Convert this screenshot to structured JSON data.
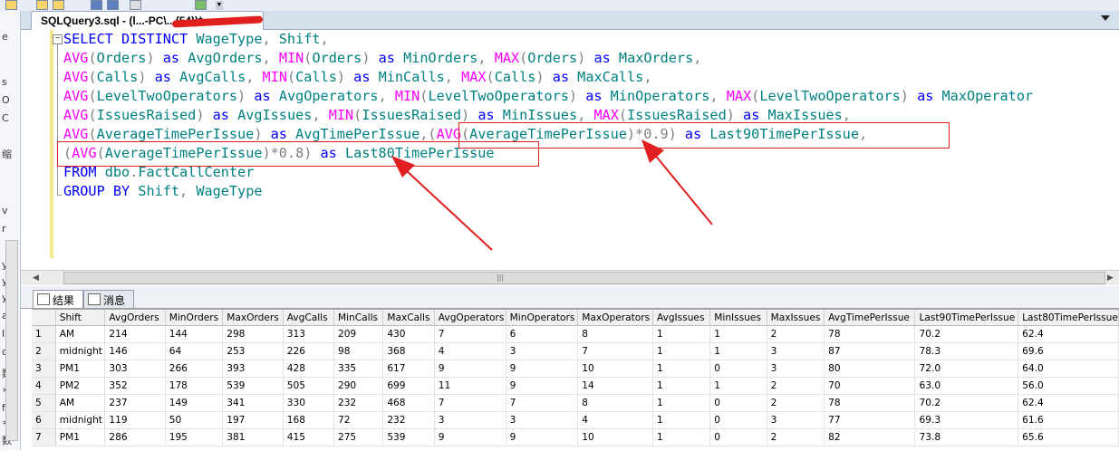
{
  "tab": {
    "title": "SQLQuery3.sql - (l...-PC\\...(54))*"
  },
  "code": {
    "l1": [
      "SELECT DISTINCT",
      "WageType",
      ",",
      "Shift",
      ","
    ],
    "l2": [
      "AVG",
      "(",
      "Orders",
      ")",
      "as",
      "AvgOrders",
      ",",
      "MIN",
      "(",
      "Orders",
      ")",
      "as",
      "MinOrders",
      ",",
      "MAX",
      "(",
      "Orders",
      ")",
      "as",
      "MaxOrders",
      ","
    ],
    "l3": [
      "AVG",
      "(",
      "Calls",
      ")",
      "as",
      "AvgCalls",
      ",",
      "MIN",
      "(",
      "Calls",
      ")",
      "as",
      "MinCalls",
      ",",
      "MAX",
      "(",
      "Calls",
      ")",
      "as",
      "MaxCalls",
      ","
    ],
    "l4": [
      "AVG",
      "(",
      "LevelTwoOperators",
      ")",
      "as",
      "AvgOperators",
      ",",
      "MIN",
      "(",
      "LevelTwoOperators",
      ")",
      "as",
      "MinOperators",
      ",",
      "MAX",
      "(",
      "LevelTwoOperators",
      ")",
      "as",
      "MaxOperator"
    ],
    "l5": [
      "AVG",
      "(",
      "IssuesRaised",
      ")",
      "as",
      "AvgIssues",
      ",",
      "MIN",
      "(",
      "IssuesRaised",
      ")",
      "as",
      "MinIssues",
      ",",
      "MAX",
      "(",
      "IssuesRaised",
      ")",
      "as",
      "MaxIssues",
      ","
    ],
    "l6": [
      "AVG",
      "(",
      "AverageTimePerIssue",
      ")",
      "as",
      "AvgTimePerIssue",
      ",",
      "(",
      "AVG",
      "(",
      "AverageTimePerIssue",
      ")",
      "*0.9)",
      "as",
      "Last90TimePerIssue",
      ","
    ],
    "l7": [
      "(",
      "AVG",
      "(",
      "AverageTimePerIssue",
      ")",
      "*0.8)",
      "as",
      "Last80TimePerIssue"
    ],
    "l8": [
      "FROM",
      "dbo",
      ".",
      "FactCallCenter"
    ],
    "l9": [
      "GROUP BY",
      "Shift",
      ",",
      "WageType"
    ]
  },
  "results": {
    "tab_results": "结果",
    "tab_messages": "消息",
    "columns": [
      "",
      "Shift",
      "AvgOrders",
      "MinOrders",
      "MaxOrders",
      "AvgCalls",
      "MinCalls",
      "MaxCalls",
      "AvgOperators",
      "MinOperators",
      "MaxOperators",
      "AvgIssues",
      "MinIssues",
      "MaxIssues",
      "AvgTimePerIssue",
      "Last90TimePerIssue",
      "Last80TimePerIssue"
    ],
    "rows": [
      [
        "1",
        "AM",
        "214",
        "144",
        "298",
        "313",
        "209",
        "430",
        "7",
        "6",
        "8",
        "1",
        "1",
        "2",
        "78",
        "70.2",
        "62.4"
      ],
      [
        "2",
        "midnight",
        "146",
        "64",
        "253",
        "226",
        "98",
        "368",
        "4",
        "3",
        "7",
        "1",
        "1",
        "3",
        "87",
        "78.3",
        "69.6"
      ],
      [
        "3",
        "PM1",
        "303",
        "266",
        "393",
        "428",
        "335",
        "617",
        "9",
        "9",
        "10",
        "1",
        "0",
        "3",
        "80",
        "72.0",
        "64.0"
      ],
      [
        "4",
        "PM2",
        "352",
        "178",
        "539",
        "505",
        "290",
        "699",
        "11",
        "9",
        "14",
        "1",
        "1",
        "2",
        "70",
        "63.0",
        "56.0"
      ],
      [
        "5",
        "AM",
        "237",
        "149",
        "341",
        "330",
        "232",
        "468",
        "7",
        "7",
        "8",
        "1",
        "0",
        "2",
        "78",
        "70.2",
        "62.4"
      ],
      [
        "6",
        "midnight",
        "119",
        "50",
        "197",
        "168",
        "72",
        "232",
        "3",
        "3",
        "4",
        "1",
        "0",
        "3",
        "77",
        "69.3",
        "61.6"
      ],
      [
        "7",
        "PM1",
        "286",
        "195",
        "381",
        "415",
        "275",
        "539",
        "9",
        "9",
        "10",
        "1",
        "0",
        "2",
        "82",
        "73.8",
        "65.6"
      ]
    ]
  },
  "left_strip_chars": [
    "e",
    "s",
    "O",
    "C",
    "缩",
    "v",
    "r",
    "y",
    "y",
    "y",
    "a",
    "I",
    "c",
    "数",
    "∗",
    "f",
    "∗",
    "数"
  ]
}
